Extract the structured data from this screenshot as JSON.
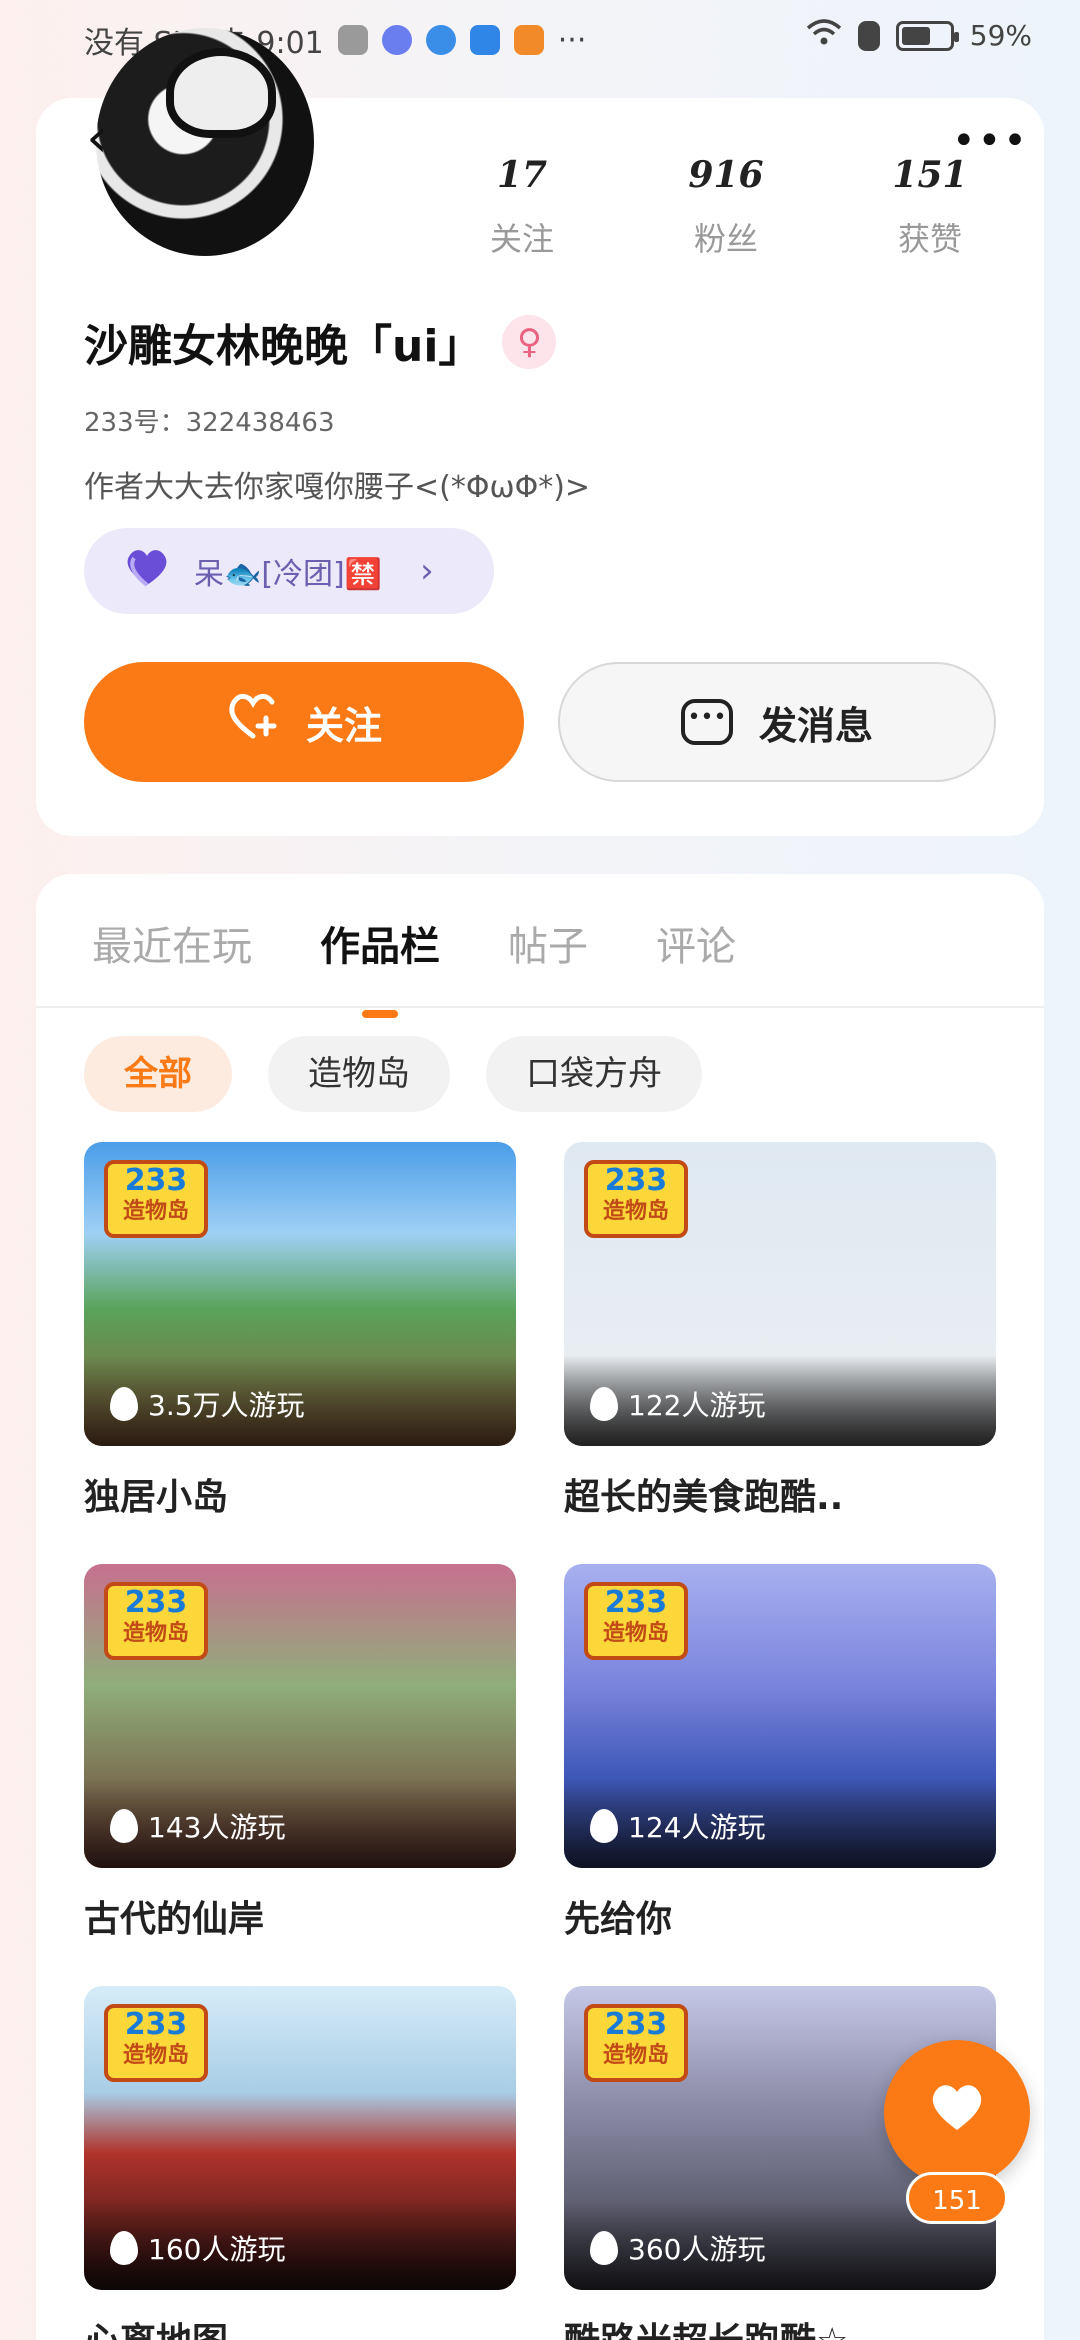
{
  "status_bar": {
    "left_text": "没有 SIM 卡 9:01",
    "more": "···",
    "battery_percent": "59%"
  },
  "profile": {
    "stats": [
      {
        "value": "17",
        "label": "关注"
      },
      {
        "value": "916",
        "label": "粉丝"
      },
      {
        "value": "151",
        "label": "获赞"
      }
    ],
    "username": "沙雕女林晚晚「ui」",
    "gender_symbol": "♀",
    "uid": "233号：322438463",
    "bio": "作者大大去你家嘎你腰子<(*ΦωΦ*)>",
    "group": {
      "text": "呆🐟[冷团]🈲",
      "chevron": "›"
    },
    "back_symbol": "‹",
    "more_symbol": "•••",
    "follow_label": "关注",
    "message_label": "发消息"
  },
  "tabs": [
    "最近在玩",
    "作品栏",
    "帖子",
    "评论"
  ],
  "active_tab": 1,
  "chips": [
    "全部",
    "造物岛",
    "口袋方舟"
  ],
  "logo": {
    "line1": "233",
    "line2": "造物岛"
  },
  "works": [
    {
      "title": "独居小岛",
      "plays": "3.5万人游玩"
    },
    {
      "title": "超长的美食跑酷..",
      "plays": "122人游玩"
    },
    {
      "title": "古代的仙岸",
      "plays": "143人游玩"
    },
    {
      "title": "先给你",
      "plays": "124人游玩"
    },
    {
      "title": "心离地图",
      "plays": "160人游玩"
    },
    {
      "title": "酷路米超长跑酷☆",
      "plays": "360人游玩"
    }
  ],
  "fab": {
    "count": "151"
  },
  "colors": {
    "accent": "#fb7a15",
    "group_bg": "#ece9fb",
    "chip_active_bg": "#fdebe0"
  }
}
